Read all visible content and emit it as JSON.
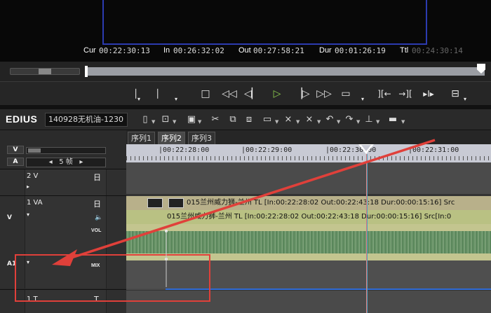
{
  "timecodes": {
    "cur_label": "Cur",
    "cur_value": "00:22:30:13",
    "in_label": "In",
    "in_value": "00:26:32:02",
    "out_label": "Out",
    "out_value": "00:27:58:21",
    "dur_label": "Dur",
    "dur_value": "00:01:26:19",
    "ttl_label": "Ttl",
    "ttl_value": "00:24:30:14"
  },
  "transport": {
    "buttons": [
      {
        "name": "mark-in-icon",
        "glyph": "❘"
      },
      {
        "name": "mark-out-icon",
        "glyph": "❘"
      },
      {
        "name": "stop-icon",
        "glyph": "□"
      },
      {
        "name": "rewind-icon",
        "glyph": "◁◁"
      },
      {
        "name": "step-back-icon",
        "glyph": "◁▏"
      },
      {
        "name": "play-icon",
        "glyph": "▷"
      },
      {
        "name": "step-forward-icon",
        "glyph": "▕▷"
      },
      {
        "name": "fast-forward-icon",
        "glyph": "▷▷"
      },
      {
        "name": "loop-icon",
        "glyph": "▭"
      },
      {
        "name": "insert-icon",
        "glyph": "][←"
      },
      {
        "name": "overwrite-icon",
        "glyph": "→]["
      },
      {
        "name": "match-frame-icon",
        "glyph": "▸I▸"
      },
      {
        "name": "export-icon",
        "glyph": "⊟"
      }
    ]
  },
  "toolbar": {
    "logo": "EDIUS",
    "project_name": "140928无机油-1230",
    "icons": [
      "new-sequence-icon",
      "open-icon",
      "save-icon",
      "cut-icon",
      "copy-icon",
      "paste-icon",
      "link-icon",
      "delete-icon",
      "ripple-delete-icon",
      "undo-icon",
      "redo-icon",
      "marker-icon",
      "render-icon"
    ]
  },
  "left_panel": {
    "top_badge": "V",
    "mode_badge": "A",
    "frames_label": "5 帧",
    "tracks": [
      {
        "name": "2 V",
        "type": "video"
      },
      {
        "name": "1 VA",
        "type": "video-audio",
        "vol_label": "VOL",
        "mix_label": "MIX"
      },
      {
        "name": "1 T",
        "type": "title"
      }
    ]
  },
  "sequences": {
    "tabs": [
      "序列1",
      "序列2",
      "序列3"
    ],
    "active_index": 1
  },
  "ruler": {
    "labels": [
      "|00:22:28:00",
      "|00:22:29:00",
      "|00:22:30:00",
      "|00:22:31:00"
    ]
  },
  "clips": {
    "video_clip_label": "015兰州威力狮-兰州  TL [In:00:22:28:02 Out:00:22:43:18 Dur:00:00:15:16]  Src",
    "audio_clip_label": "015兰州威力狮-兰州  TL [In:00:22:28:02 Out:00:22:43:18 Dur:00:00:15:16]  Src[In:0"
  },
  "annotation": {
    "color": "#e0403a"
  }
}
